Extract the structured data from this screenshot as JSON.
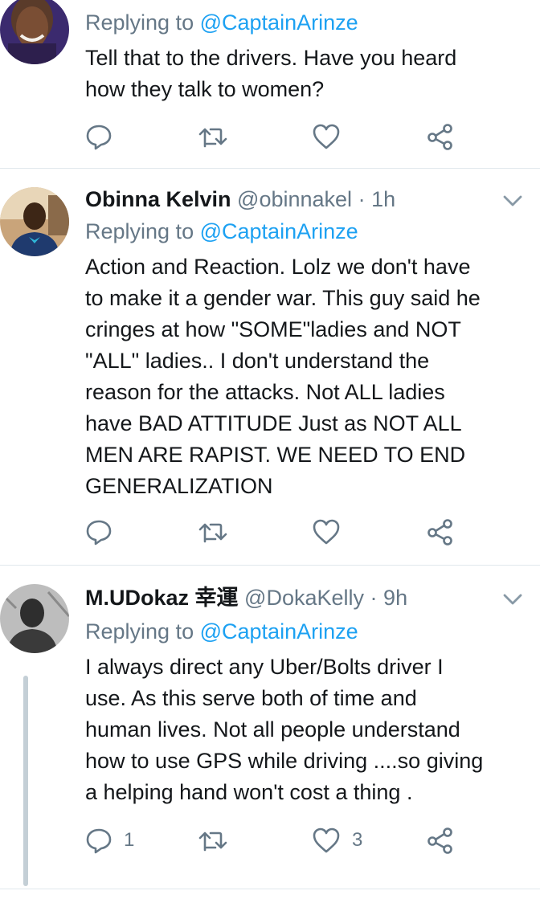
{
  "colors": {
    "link": "#1da1f2",
    "muted": "#657786",
    "text": "#14171a",
    "divider": "#e1e8ed",
    "thread_line": "#c4cfd6"
  },
  "tweets": [
    {
      "reply_prefix": "Replying to",
      "reply_to": "@CaptainArinze",
      "text_lines": [
        "Tell that to the drivers. Have you heard",
        "how they talk to women?"
      ],
      "actions": {
        "reply_icon": "reply-icon",
        "retweet_icon": "retweet-icon",
        "like_icon": "heart-icon",
        "share_icon": "share-icon"
      }
    },
    {
      "name": "Obinna Kelvin",
      "handle": "@obinnakel",
      "separator": "·",
      "time": "1h",
      "reply_prefix": "Replying to",
      "reply_to": "@CaptainArinze",
      "text_lines": [
        "Action and Reaction. Lolz we don't have",
        "to make it a gender war. This guy said he",
        "cringes at how \"SOME\"ladies and NOT",
        "\"ALL\" ladies.. I don't understand the",
        "reason for the attacks. Not ALL ladies",
        "have BAD ATTITUDE Just as NOT ALL",
        "MEN ARE RAPIST. WE NEED TO END",
        "GENERALIZATION"
      ],
      "actions": {
        "reply_icon": "reply-icon",
        "retweet_icon": "retweet-icon",
        "like_icon": "heart-icon",
        "share_icon": "share-icon"
      }
    },
    {
      "name": "M.UDokaz 幸運",
      "handle": "@DokaKelly",
      "separator": "·",
      "time": "9h",
      "reply_prefix": "Replying to",
      "reply_to": "@CaptainArinze",
      "text_lines": [
        "I always direct any Uber/Bolts driver I",
        "use. As this serve both of time and",
        "human lives. Not all people understand",
        "how to use GPS while driving ....so giving",
        "a helping hand won't cost a thing ."
      ],
      "reply_count": "1",
      "like_count": "3",
      "actions": {
        "reply_icon": "reply-icon",
        "retweet_icon": "retweet-icon",
        "like_icon": "heart-icon",
        "share_icon": "share-icon"
      }
    }
  ]
}
